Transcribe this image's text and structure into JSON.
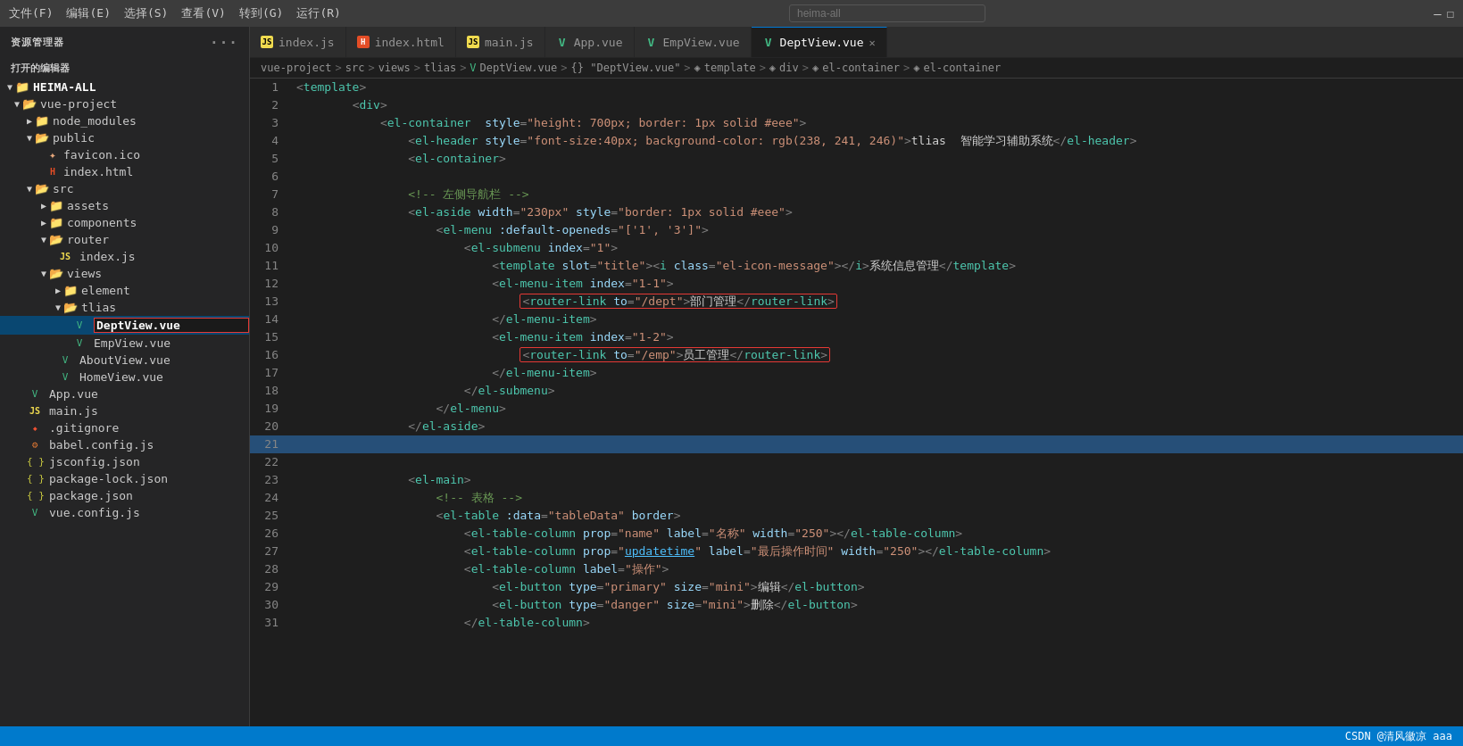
{
  "menubar": {
    "items": [
      "文件(F)",
      "编辑(E)",
      "选择(S)",
      "查看(V)",
      "转到(G)",
      "运行(R)"
    ],
    "search_placeholder": "heima-all",
    "nav_back": "←",
    "nav_forward": "→"
  },
  "sidebar": {
    "title": "资源管理器",
    "dots": "···",
    "open_editors_label": "打开的编辑器",
    "root": "HEIMA-ALL",
    "tree": [
      {
        "id": "vue-project",
        "label": "vue-project",
        "type": "folder-open",
        "level": 1,
        "expanded": true
      },
      {
        "id": "node_modules",
        "label": "node_modules",
        "type": "folder",
        "level": 2,
        "expanded": false
      },
      {
        "id": "public",
        "label": "public",
        "type": "folder-open",
        "level": 2,
        "expanded": true
      },
      {
        "id": "favicon",
        "label": "favicon.ico",
        "type": "img",
        "level": 3
      },
      {
        "id": "index-html-public",
        "label": "index.html",
        "type": "html",
        "level": 3
      },
      {
        "id": "src",
        "label": "src",
        "type": "folder-open",
        "level": 2,
        "expanded": true
      },
      {
        "id": "assets",
        "label": "assets",
        "type": "folder",
        "level": 3,
        "expanded": false
      },
      {
        "id": "components",
        "label": "components",
        "type": "folder",
        "level": 3,
        "expanded": false
      },
      {
        "id": "router",
        "label": "router",
        "type": "folder-open",
        "level": 3,
        "expanded": true
      },
      {
        "id": "index-js",
        "label": "index.js",
        "type": "js",
        "level": 4
      },
      {
        "id": "views",
        "label": "views",
        "type": "folder-open",
        "level": 3,
        "expanded": true
      },
      {
        "id": "element",
        "label": "element",
        "type": "folder",
        "level": 4,
        "expanded": false
      },
      {
        "id": "tlias",
        "label": "tlias",
        "type": "folder-open",
        "level": 4,
        "expanded": true
      },
      {
        "id": "DeptView",
        "label": "DeptView.vue",
        "type": "vue",
        "level": 5,
        "selected": true
      },
      {
        "id": "EmpView",
        "label": "EmpView.vue",
        "type": "vue",
        "level": 5
      },
      {
        "id": "AboutView",
        "label": "AboutView.vue",
        "type": "vue",
        "level": 4
      },
      {
        "id": "HomeView",
        "label": "HomeView.vue",
        "type": "vue",
        "level": 4
      },
      {
        "id": "App-vue",
        "label": "App.vue",
        "type": "vue",
        "level": 2
      },
      {
        "id": "main-js",
        "label": "main.js",
        "type": "js",
        "level": 2
      },
      {
        "id": "gitignore",
        "label": ".gitignore",
        "type": "git",
        "level": 2
      },
      {
        "id": "babel",
        "label": "babel.config.js",
        "type": "config",
        "level": 2
      },
      {
        "id": "jsconfig",
        "label": "jsconfig.json",
        "type": "json",
        "level": 2
      },
      {
        "id": "package-lock",
        "label": "package-lock.json",
        "type": "json",
        "level": 2
      },
      {
        "id": "package",
        "label": "package.json",
        "type": "json",
        "level": 2
      },
      {
        "id": "vue-config",
        "label": "vue.config.js",
        "type": "vue",
        "level": 2
      }
    ]
  },
  "tabs": [
    {
      "id": "index-js-tab",
      "label": "index.js",
      "type": "js",
      "active": false
    },
    {
      "id": "index-html-tab",
      "label": "index.html",
      "type": "html",
      "active": false
    },
    {
      "id": "main-js-tab",
      "label": "main.js",
      "type": "js",
      "active": false
    },
    {
      "id": "app-vue-tab",
      "label": "App.vue",
      "type": "vue",
      "active": false
    },
    {
      "id": "empview-tab",
      "label": "EmpView.vue",
      "type": "vue",
      "active": false
    },
    {
      "id": "deptview-tab",
      "label": "DeptView.vue",
      "type": "vue",
      "active": true,
      "closeable": true
    }
  ],
  "breadcrumb": [
    "vue-project",
    ">",
    "src",
    ">",
    "views",
    ">",
    "tlias",
    ">",
    "DeptView.vue",
    ">",
    "{} \"DeptView.vue\"",
    ">",
    "template",
    ">",
    "div",
    ">",
    "el-container",
    ">",
    "el-container"
  ],
  "code_lines": [
    {
      "num": 1,
      "content": "    <template>"
    },
    {
      "num": 2,
      "content": "        <div>"
    },
    {
      "num": 3,
      "content": "            <el-container  style=\"height: 700px; border: 1px solid #eee\">"
    },
    {
      "num": 4,
      "content": "                <el-header style=\"font-size:40px; background-color: rgb(238, 241, 246)\">tlias  智能学习辅助系统</el-header>"
    },
    {
      "num": 5,
      "content": "                <el-container>"
    },
    {
      "num": 6,
      "content": ""
    },
    {
      "num": 7,
      "content": "                <!-- 左侧导航栏 -->"
    },
    {
      "num": 8,
      "content": "                <el-aside width=\"230px\" style=\"border: 1px solid #eee\">"
    },
    {
      "num": 9,
      "content": "                    <el-menu :default-openeds=\"['1', '3']\">"
    },
    {
      "num": 10,
      "content": "                        <el-submenu index=\"1\">"
    },
    {
      "num": 11,
      "content": "                            <template slot=\"title\"><i class=\"el-icon-message\"></i>系统信息管理</template>"
    },
    {
      "num": 12,
      "content": "                            <el-menu-item index=\"1-1\">"
    },
    {
      "num": 13,
      "content": "                                <router-link to=\"/dept\">部门管理</router-link>",
      "highlight": true
    },
    {
      "num": 14,
      "content": "                            </el-menu-item>"
    },
    {
      "num": 15,
      "content": "                            <el-menu-item index=\"1-2\">"
    },
    {
      "num": 16,
      "content": "                                <router-link to=\"/emp\">员工管理</router-link>",
      "highlight": true
    },
    {
      "num": 17,
      "content": "                            </el-menu-item>"
    },
    {
      "num": 18,
      "content": "                        </el-submenu>"
    },
    {
      "num": 19,
      "content": "                    </el-menu>"
    },
    {
      "num": 20,
      "content": "                </el-aside>"
    },
    {
      "num": 21,
      "content": "",
      "cursor": true
    },
    {
      "num": 22,
      "content": ""
    },
    {
      "num": 23,
      "content": "                <el-main>"
    },
    {
      "num": 24,
      "content": "                    <!-- 表格 -->"
    },
    {
      "num": 25,
      "content": "                    <el-table :data=\"tableData\" border>"
    },
    {
      "num": 26,
      "content": "                        <el-table-column prop=\"name\" label=\"名称\" width=\"250\"></el-table-column>"
    },
    {
      "num": 27,
      "content": "                        <el-table-column prop=\"updatetime\" label=\"最后操作时间\" width=\"250\"></el-table-column>"
    },
    {
      "num": 28,
      "content": "                        <el-table-column label=\"操作\">"
    },
    {
      "num": 29,
      "content": "                            <el-button type=\"primary\" size=\"mini\">编辑</el-button>"
    },
    {
      "num": 30,
      "content": "                            <el-button type=\"danger\" size=\"mini\">删除</el-button>"
    },
    {
      "num": 31,
      "content": "                        </el-table-column>"
    }
  ],
  "statusbar": {
    "right_text": "CSDN @清风徽凉 aaa"
  }
}
